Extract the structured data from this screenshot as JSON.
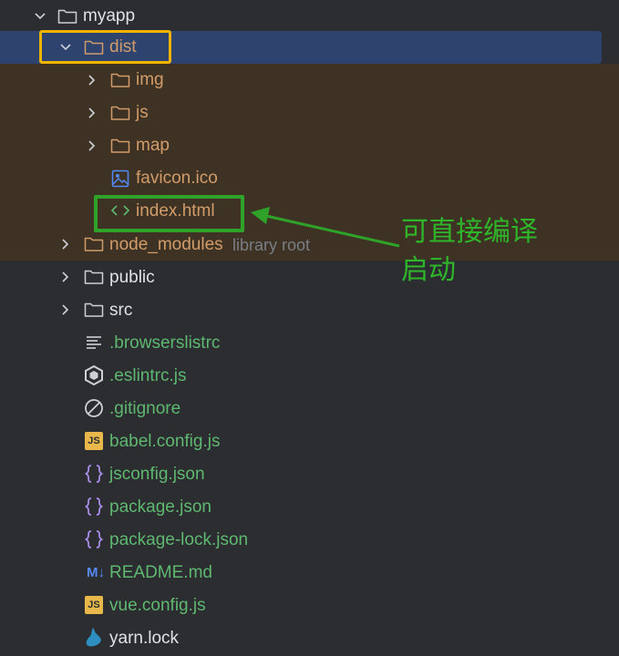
{
  "tree": {
    "root": {
      "label": "myapp"
    },
    "dist": {
      "label": "dist"
    },
    "dist_children": {
      "img": "img",
      "js": "js",
      "map": "map",
      "favicon": "favicon.ico",
      "index": "index.html"
    },
    "node_modules": {
      "label": "node_modules",
      "hint": "library root"
    },
    "public": "public",
    "src": "src",
    "files": {
      "browserslistrc": ".browserslistrc",
      "eslintrc": ".eslintrc.js",
      "gitignore": ".gitignore",
      "babel": "babel.config.js",
      "jsconfig": "jsconfig.json",
      "package": "package.json",
      "package_lock": "package-lock.json",
      "readme": "README.md",
      "vue_config": "vue.config.js",
      "yarn": "yarn.lock"
    }
  },
  "annotation": {
    "line1": "可直接编译",
    "line2": "启动"
  },
  "icons": {
    "js_badge": "JS",
    "md_badge": "M↓"
  },
  "colors": {
    "background": "#2b2d30",
    "selected_row": "#2e436e",
    "excluded_bg": "#3d3223",
    "excluded_text": "#d29c6a",
    "modified_text": "#5fb870",
    "highlight_yellow": "#f0b400",
    "highlight_green": "#2fa329"
  }
}
